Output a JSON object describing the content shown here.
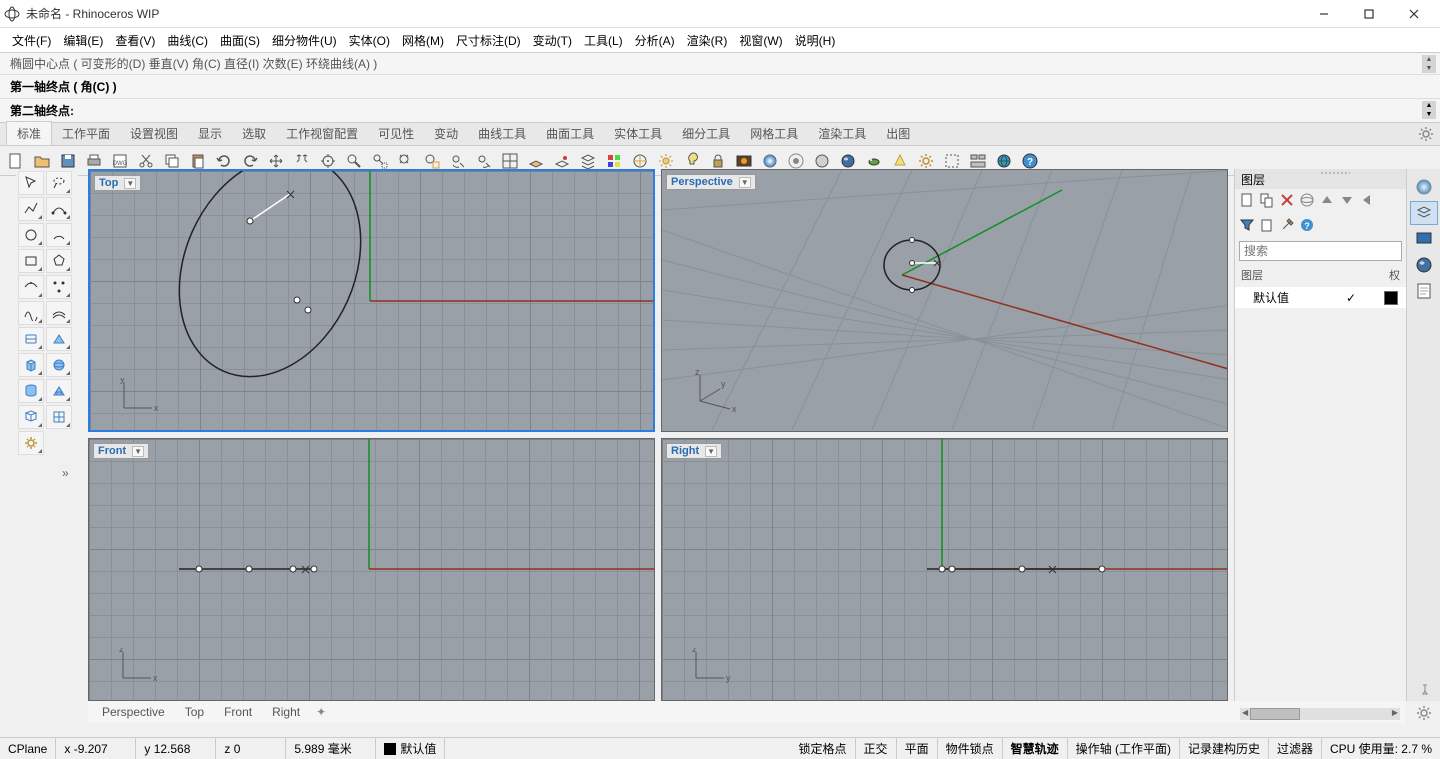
{
  "window": {
    "title": "未命名 - Rhinoceros WIP"
  },
  "menu": [
    "文件(F)",
    "编辑(E)",
    "查看(V)",
    "曲线(C)",
    "曲面(S)",
    "细分物件(U)",
    "实体(O)",
    "网格(M)",
    "尺寸标注(D)",
    "变动(T)",
    "工具(L)",
    "分析(A)",
    "渲染(R)",
    "视窗(W)",
    "说明(H)"
  ],
  "cmd_history": "椭圆中心点 ( 可变形的(D)  垂直(V)  角(C)  直径(I)  次数(E)  环绕曲线(A) )",
  "cmd_line1": "第一轴终点 ( 角(C) )",
  "cmd_line2": "第二轴终点:",
  "tabbar": [
    "标准",
    "工作平面",
    "设置视图",
    "显示",
    "选取",
    "工作视窗配置",
    "可见性",
    "变动",
    "曲线工具",
    "曲面工具",
    "实体工具",
    "细分工具",
    "网格工具",
    "渲染工具",
    "出图"
  ],
  "tabbar_active": 0,
  "viewports": {
    "top": {
      "label": "Top",
      "active": true,
      "axes": [
        "x",
        "y"
      ]
    },
    "persp": {
      "label": "Perspective",
      "active": false,
      "axes": [
        "x",
        "y",
        "z"
      ]
    },
    "front": {
      "label": "Front",
      "active": false,
      "axes": [
        "x",
        "z"
      ]
    },
    "right": {
      "label": "Right",
      "active": false,
      "axes": [
        "y",
        "z"
      ]
    }
  },
  "layers": {
    "title": "图层",
    "search_ph": "搜索",
    "col_header": "图层",
    "col_header2": "权",
    "default_name": "默认值"
  },
  "viewtabs": [
    "Perspective",
    "Top",
    "Front",
    "Right"
  ],
  "status": {
    "cplane": "CPlane",
    "x": "x -9.207",
    "y": "y 12.568",
    "z": "z 0",
    "units": "5.989 毫米",
    "layer": "默认值",
    "gridsnap": "锁定格点",
    "ortho": "正交",
    "planar": "平面",
    "osnap": "物件锁点",
    "smarttrack": "智慧轨迹",
    "gumball": "操作轴 (工作平面)",
    "history": "记录建构历史",
    "filter": "过滤器",
    "cpu": "CPU 使用量: 2.7 %"
  }
}
